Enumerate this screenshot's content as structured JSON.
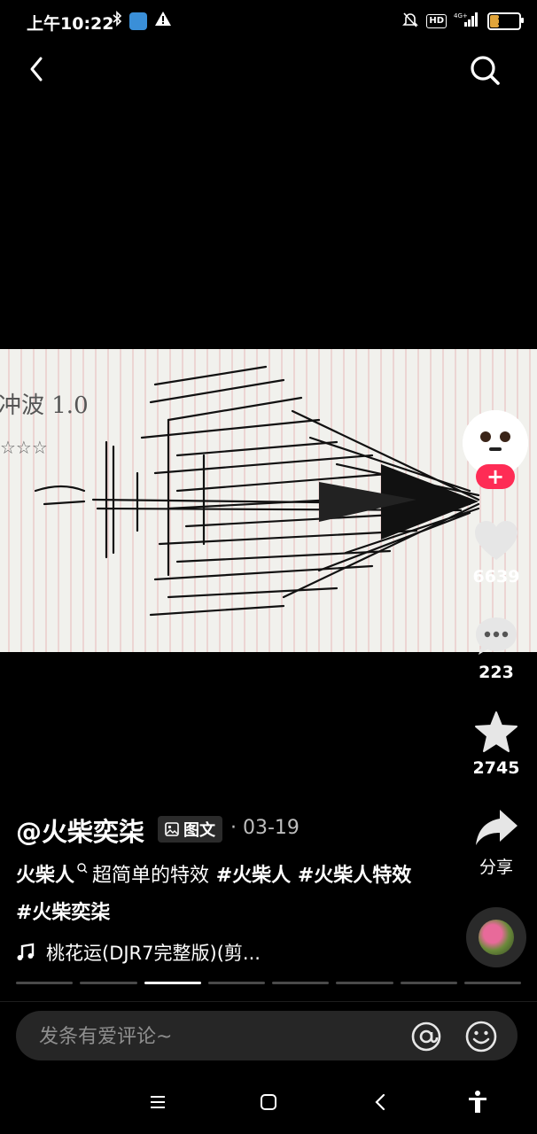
{
  "status_bar": {
    "time": "上午10:22",
    "battery": "29"
  },
  "rail": {
    "likes": "6639",
    "comments": "223",
    "favorites": "2745",
    "share_label": "分享"
  },
  "post": {
    "author": "@火柴奕柒",
    "type_badge": "图文",
    "date": "· 03-19",
    "caption_prefix": "火柴人",
    "caption_text": "超简单的特效",
    "hashtags": [
      "#火柴人",
      "#火柴人特效",
      "#火柴奕柒"
    ],
    "music": "桃花运(DJR7完整版)(剪..."
  },
  "image_texts": {
    "note_line1": "冲波 1.0",
    "note_line2": "☆☆☆"
  },
  "progress": {
    "total": 8,
    "active_index": 2
  },
  "comment": {
    "placeholder": "发条有爱评论~"
  },
  "colors": {
    "accent": "#fe2c55",
    "background": "#000000",
    "pill": "#2b2b2b"
  },
  "icons": [
    "back-icon",
    "search-icon",
    "heart-icon",
    "comment-icon",
    "star-icon",
    "share-icon",
    "music-note-icon",
    "at-icon",
    "emoji-icon",
    "menu-icon",
    "home-square-icon",
    "nav-back-icon",
    "accessibility-icon",
    "bluetooth-icon",
    "alert-icon",
    "mute-icon",
    "hd-icon",
    "signal-icon"
  ]
}
